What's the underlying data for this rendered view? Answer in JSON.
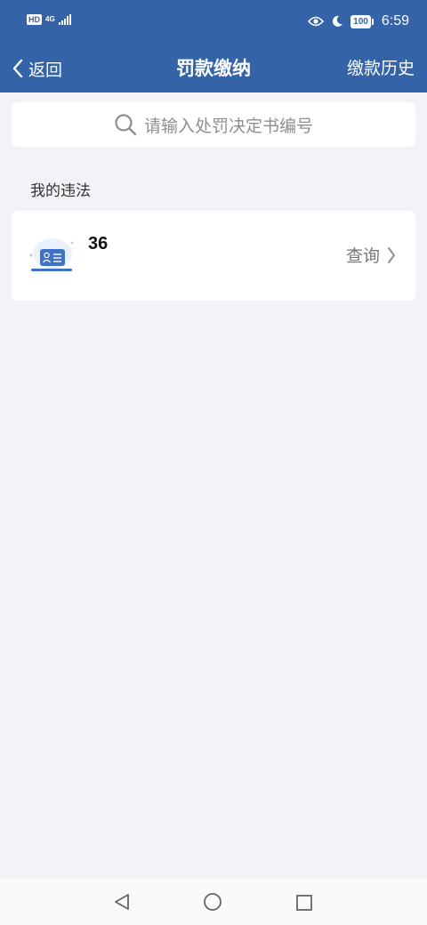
{
  "status_bar": {
    "hd_badge": "HD",
    "network": "4G",
    "battery": "100",
    "time": "6:59",
    "icons": [
      "eye-icon",
      "moon-icon"
    ]
  },
  "nav": {
    "back_label": "返回",
    "title": "罚款缴纳",
    "history_label": "缴款历史"
  },
  "search": {
    "placeholder": "请输入处罚决定书编号"
  },
  "section": {
    "label": "我的违法"
  },
  "violation_card": {
    "number": "36",
    "action_label": "查询"
  },
  "colors": {
    "header": "#3563a8",
    "background": "#f2f2f7",
    "card": "#ffffff"
  }
}
